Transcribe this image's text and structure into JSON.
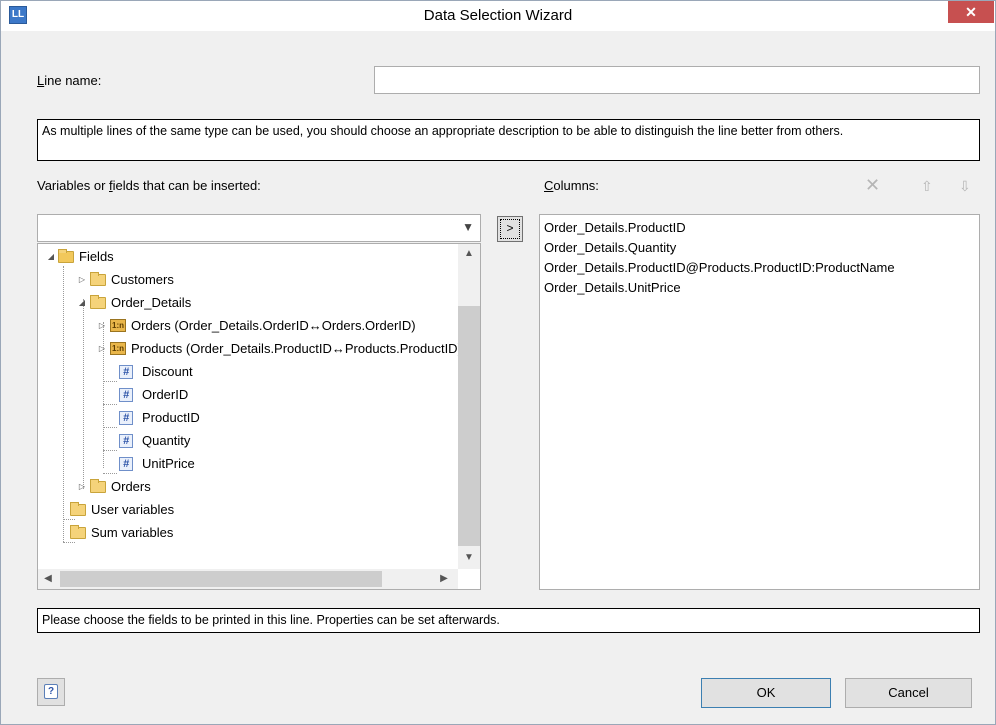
{
  "window": {
    "title": "Data Selection Wizard",
    "app_icon": "LL",
    "close": "✕"
  },
  "line_name": {
    "label_prefix": "L",
    "label_rest": "ine name:",
    "value": ""
  },
  "description_info": "As multiple lines of the same type can be used, you should choose an appropriate description to be able to distinguish the line better from others.",
  "variables": {
    "label_pre": "Variables or ",
    "label_u": "f",
    "label_post": "ields that can be inserted:",
    "combo_value": "",
    "tree": [
      {
        "label": "Fields",
        "icon": "table-folder-icon",
        "expanded": true
      },
      {
        "label": "Customers",
        "icon": "folder-icon",
        "expanded": false
      },
      {
        "label": "Order_Details",
        "icon": "folder-icon",
        "expanded": true
      },
      {
        "label": "Orders (Order_Details.OrderID↔Orders.OrderID)",
        "icon": "relation-icon",
        "expanded": false
      },
      {
        "label": "Products (Order_Details.ProductID↔Products.ProductID)",
        "icon": "relation-icon",
        "expanded": false
      },
      {
        "label": "Discount",
        "icon": "numeric-field-icon"
      },
      {
        "label": "OrderID",
        "icon": "numeric-field-icon"
      },
      {
        "label": "ProductID",
        "icon": "numeric-field-icon"
      },
      {
        "label": "Quantity",
        "icon": "numeric-field-icon"
      },
      {
        "label": "UnitPrice",
        "icon": "numeric-field-icon"
      },
      {
        "label": "Orders",
        "icon": "folder-icon",
        "expanded": false
      },
      {
        "label": "User variables",
        "icon": "user-variables-icon"
      },
      {
        "label": "Sum variables",
        "icon": "sum-variables-icon"
      }
    ]
  },
  "add_button": ">",
  "columns": {
    "label_u": "C",
    "label_rest": "olumns:",
    "items": [
      "Order_Details.ProductID",
      "Order_Details.Quantity",
      "Order_Details.ProductID@Products.ProductID:ProductName",
      "Order_Details.UnitPrice"
    ],
    "delete_icon": "✕",
    "up_icon": "⇧",
    "down_icon": "⇩"
  },
  "status_info": "Please choose the fields to be printed in this line. Properties can be set afterwards.",
  "buttons": {
    "ok": "OK",
    "cancel": "Cancel",
    "help": "?"
  },
  "colors": {
    "close_button": "#c75050",
    "dialog_bg": "#f0f0f0",
    "folder": "#f5d37a"
  }
}
